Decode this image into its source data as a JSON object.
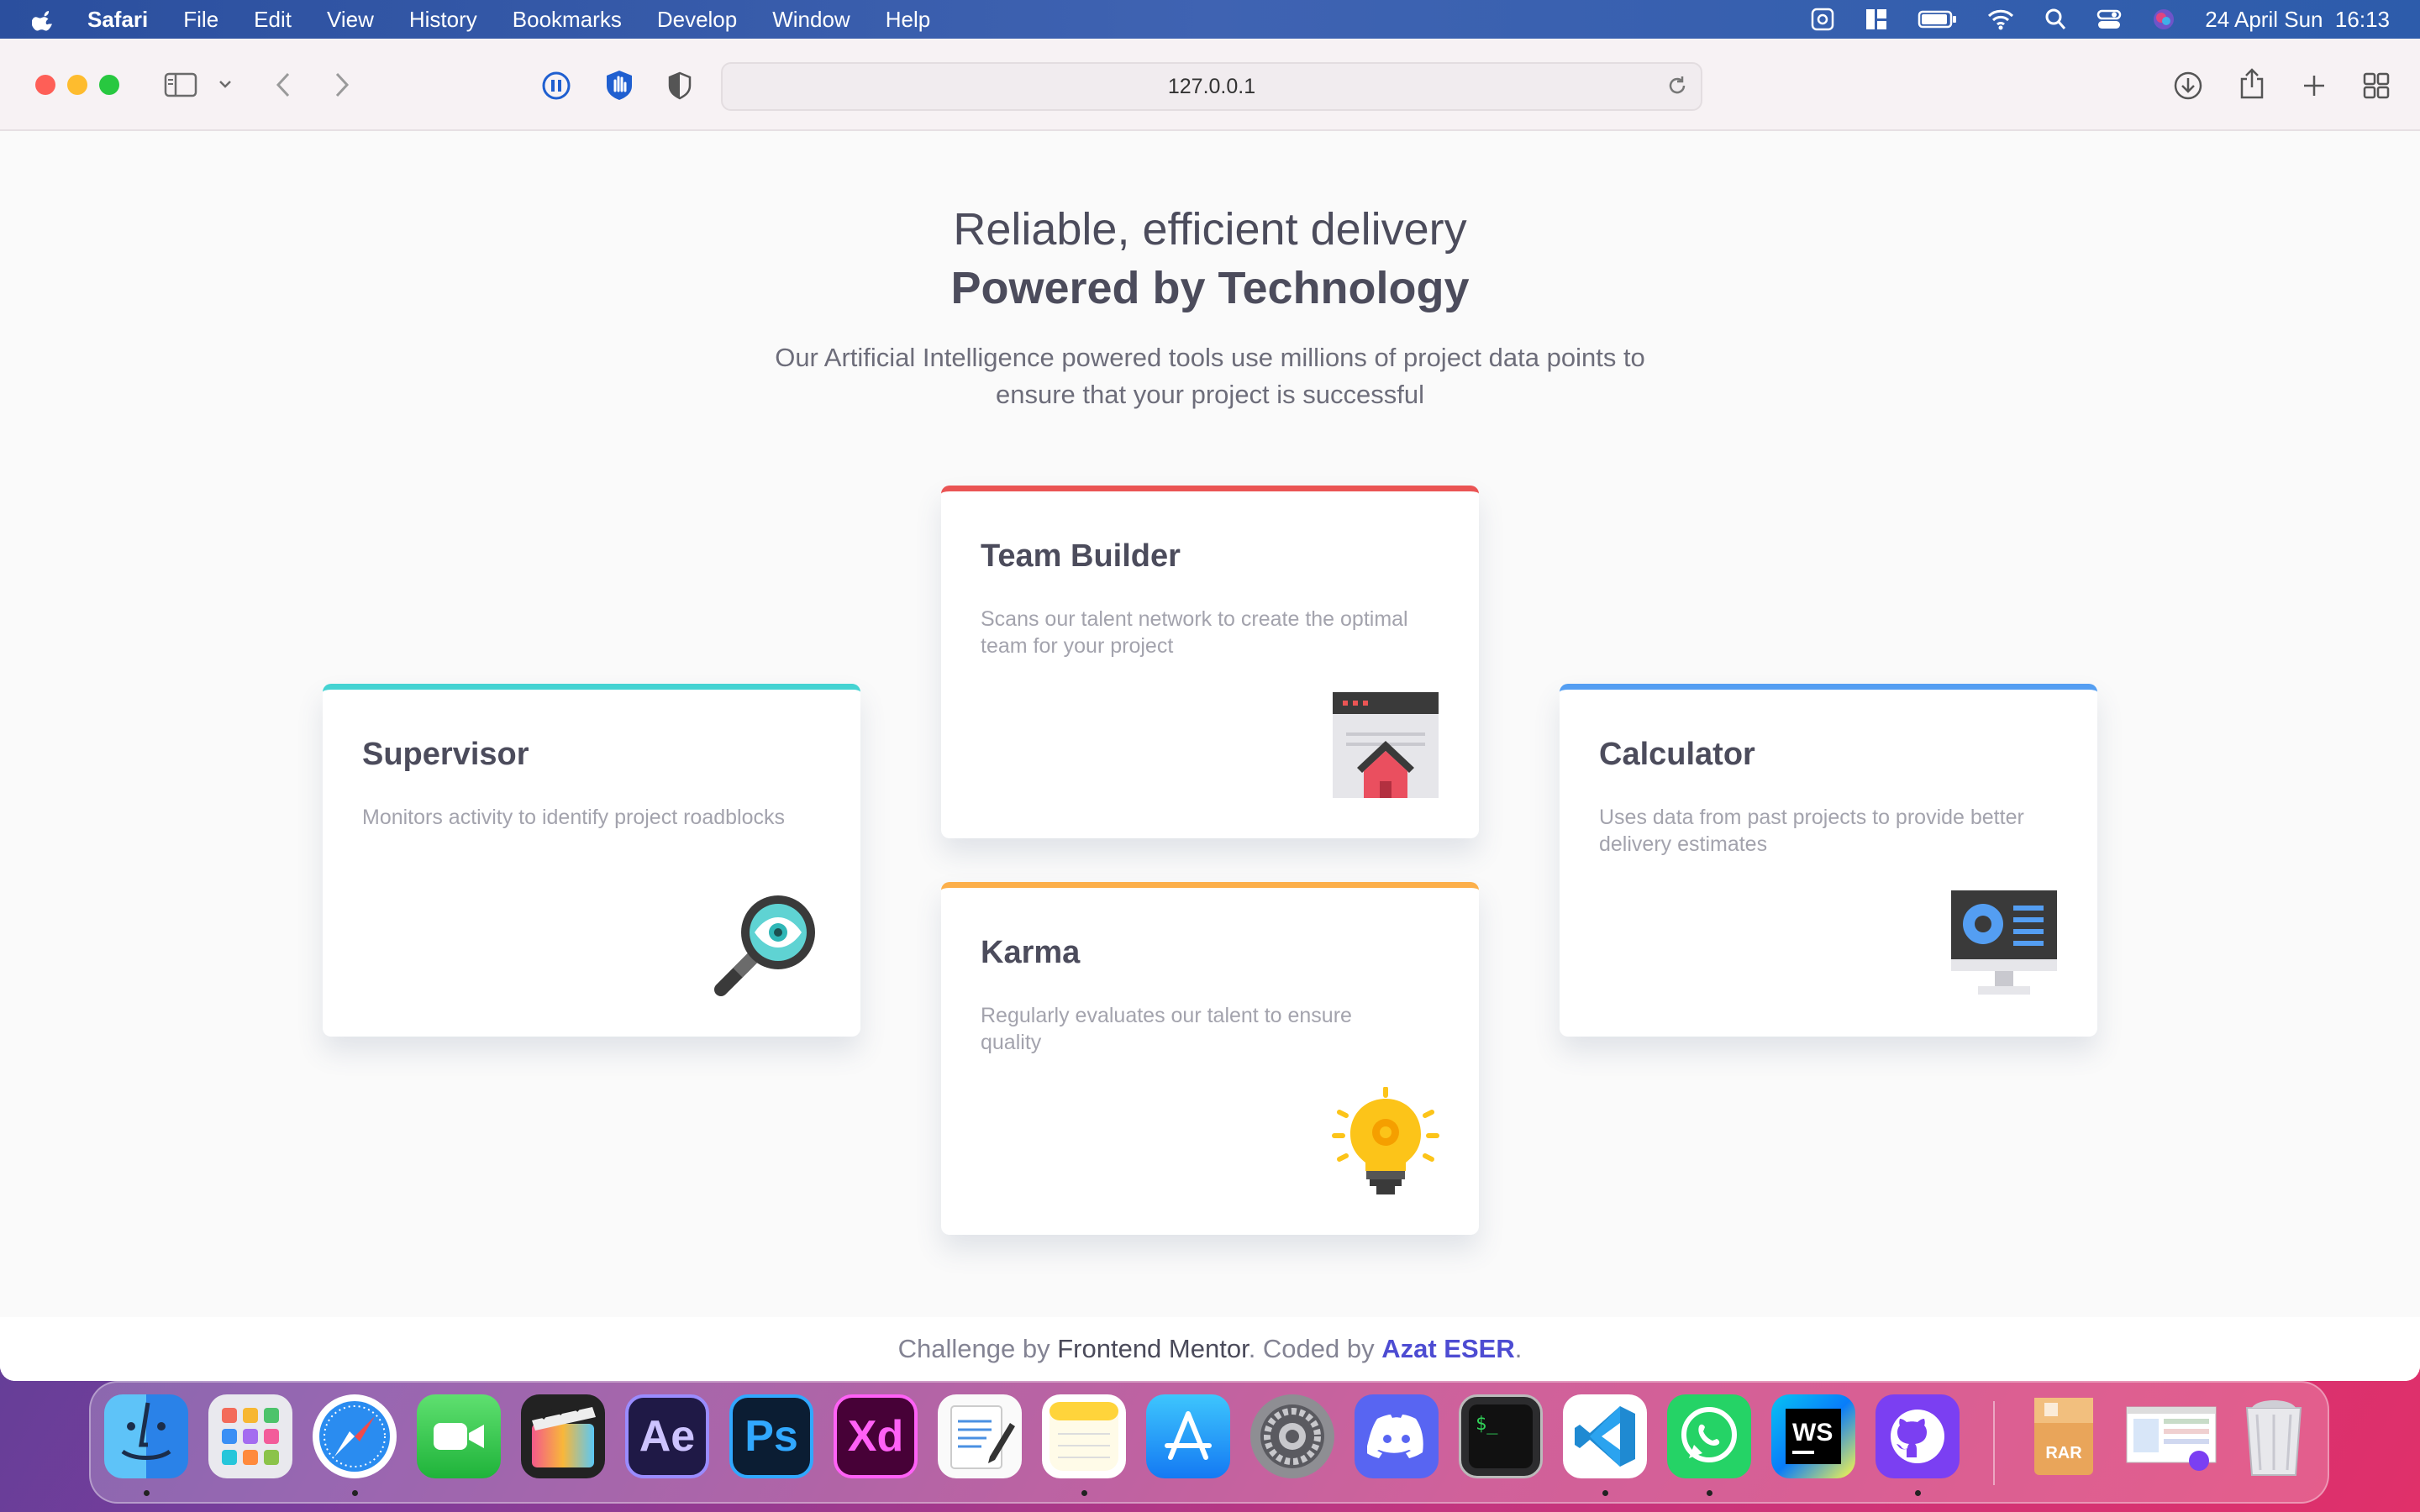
{
  "menubar": {
    "app_name": "Safari",
    "items": [
      "File",
      "Edit",
      "View",
      "History",
      "Bookmarks",
      "Develop",
      "Window",
      "Help"
    ],
    "clock": "24 April Sun  16:13"
  },
  "browser": {
    "url": "127.0.0.1"
  },
  "hero": {
    "line1": "Reliable, efficient delivery",
    "line2": "Powered by Technology",
    "intro": "Our Artificial Intelligence powered tools use millions of project data points to ensure that your project is successful"
  },
  "cards": [
    {
      "title": "Supervisor",
      "description": "Monitors activity to identify project roadblocks",
      "accent": "#44d3d2",
      "icon": "magnifier-eye-icon"
    },
    {
      "title": "Team Builder",
      "description": "Scans our talent network to create the optimal team for your project",
      "accent": "#ea5454",
      "icon": "browser-house-icon"
    },
    {
      "title": "Karma",
      "description": "Regularly evaluates our talent to ensure quality",
      "accent": "#fcaf4a",
      "icon": "lightbulb-icon"
    },
    {
      "title": "Calculator",
      "description": "Uses data from past projects to provide better delivery estimates",
      "accent": "#549ef2",
      "icon": "monitor-chart-icon"
    }
  ],
  "footer": {
    "prefix": "Challenge by ",
    "mentor": "Frontend Mentor",
    "middle": ". Coded by ",
    "author": "Azat ESER",
    "suffix": "."
  },
  "dock": {
    "apps": [
      "Finder",
      "Launchpad",
      "Safari",
      "FaceTime",
      "Final Cut Pro",
      "After Effects",
      "Photoshop",
      "Adobe XD",
      "TextEdit",
      "Notes",
      "App Store",
      "System Preferences",
      "Discord",
      "Terminal",
      "Visual Studio Code",
      "WhatsApp",
      "WebStorm",
      "GitHub Desktop",
      "RAR Archive",
      "Screenshot",
      "Trash"
    ],
    "labels": {
      "ae": "Ae",
      "ps": "Ps",
      "xd": "Xd",
      "ws": "WS",
      "rar": "RAR"
    }
  }
}
